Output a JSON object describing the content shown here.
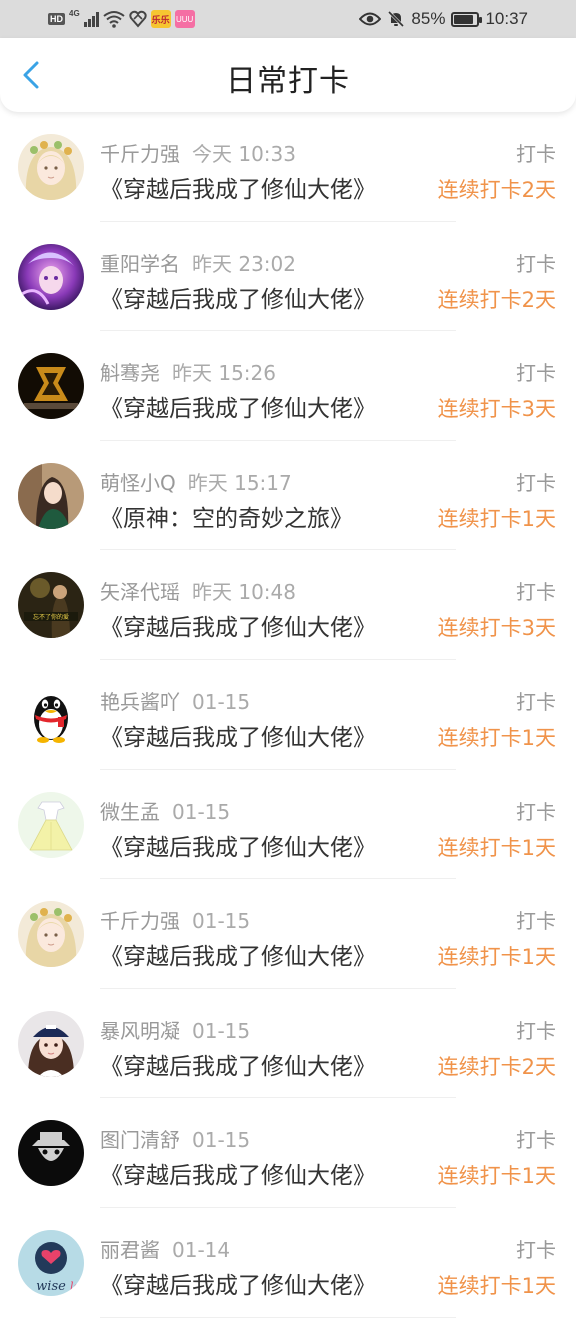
{
  "status_bar": {
    "hd": "HD",
    "network": "4G",
    "app1": "乐乐",
    "app2": "UUU",
    "battery": "85%",
    "battery_level": 0.85,
    "time": "10:37"
  },
  "header": {
    "title": "日常打卡"
  },
  "colors": {
    "streak": "#f0934a",
    "back": "#3aa3e6"
  },
  "entries": [
    {
      "user": "千斤力强",
      "time": "今天 10:33",
      "book": "《穿越后我成了修仙大佬》",
      "label": "打卡",
      "streak": "连续打卡2天",
      "avatar": "anime-girl-flowers"
    },
    {
      "user": "重阳学名",
      "time": "昨天 23:02",
      "book": "《穿越后我成了修仙大佬》",
      "label": "打卡",
      "streak": "连续打卡2天",
      "avatar": "purple-game-character"
    },
    {
      "user": "斛骞尧",
      "time": "昨天 15:26",
      "book": "《穿越后我成了修仙大佬》",
      "label": "打卡",
      "streak": "连续打卡3天",
      "avatar": "dark-gold-emblem"
    },
    {
      "user": "萌怪小Q",
      "time": "昨天 15:17",
      "book": "《原神：空的奇妙之旅》",
      "label": "打卡",
      "streak": "连续打卡1天",
      "avatar": "girl-photo"
    },
    {
      "user": "矢泽代瑶",
      "time": "昨天 10:48",
      "book": "《穿越后我成了修仙大佬》",
      "label": "打卡",
      "streak": "连续打卡3天",
      "avatar": "dark-forest-photo"
    },
    {
      "user": "艳兵酱吖",
      "time": "01-15",
      "book": "《穿越后我成了修仙大佬》",
      "label": "打卡",
      "streak": "连续打卡1天",
      "avatar": "penguin"
    },
    {
      "user": "微生孟",
      "time": "01-15",
      "book": "《穿越后我成了修仙大佬》",
      "label": "打卡",
      "streak": "连续打卡1天",
      "avatar": "dress-illustration"
    },
    {
      "user": "千斤力强",
      "time": "01-15",
      "book": "《穿越后我成了修仙大佬》",
      "label": "打卡",
      "streak": "连续打卡1天",
      "avatar": "anime-girl-flowers"
    },
    {
      "user": "暴风明凝",
      "time": "01-15",
      "book": "《穿越后我成了修仙大佬》",
      "label": "打卡",
      "streak": "连续打卡2天",
      "avatar": "girl-with-cap"
    },
    {
      "user": "图门清舒",
      "time": "01-15",
      "book": "《穿越后我成了修仙大佬》",
      "label": "打卡",
      "streak": "连续打卡1天",
      "avatar": "dark-hat-logo"
    },
    {
      "user": "丽君酱",
      "time": "01-14",
      "book": "《穿越后我成了修仙大佬》",
      "label": "打卡",
      "streak": "连续打卡1天",
      "avatar": "wiselove-logo"
    }
  ]
}
